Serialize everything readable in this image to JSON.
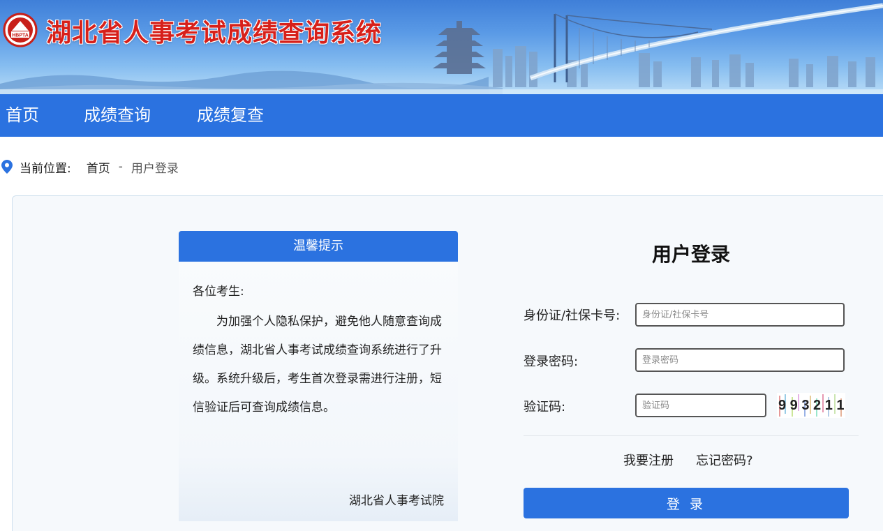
{
  "header": {
    "title": "湖北省人事考试成绩查询系统",
    "logo_text": "HBPTA"
  },
  "nav": {
    "items": [
      {
        "label": "首页"
      },
      {
        "label": "成绩查询"
      },
      {
        "label": "成绩复查"
      }
    ]
  },
  "breadcrumb": {
    "label": "当前位置:",
    "home": "首页",
    "separator": "-",
    "current": "用户登录"
  },
  "notice": {
    "title": "温馨提示",
    "greeting": "各位考生:",
    "body": "为加强个人隐私保护，避免他人随意查询成绩信息，湖北省人事考试成绩查询系统进行了升级。系统升级后，考生首次登录需进行注册，短信验证后可查询成绩信息。",
    "signature": "湖北省人事考试院"
  },
  "login": {
    "title": "用户登录",
    "id_label": "身份证/社保卡号:",
    "id_placeholder": "身份证/社保卡号",
    "password_label": "登录密码:",
    "password_placeholder": "登录密码",
    "captcha_label": "验证码:",
    "captcha_placeholder": "验证码",
    "captcha_text": "9 9 3 2 1 1",
    "register_link": "我要注册",
    "forgot_link": "忘记密码?",
    "submit_label": "登 录"
  },
  "colors": {
    "primary": "#2b72e0",
    "title_red": "#d7201a"
  }
}
